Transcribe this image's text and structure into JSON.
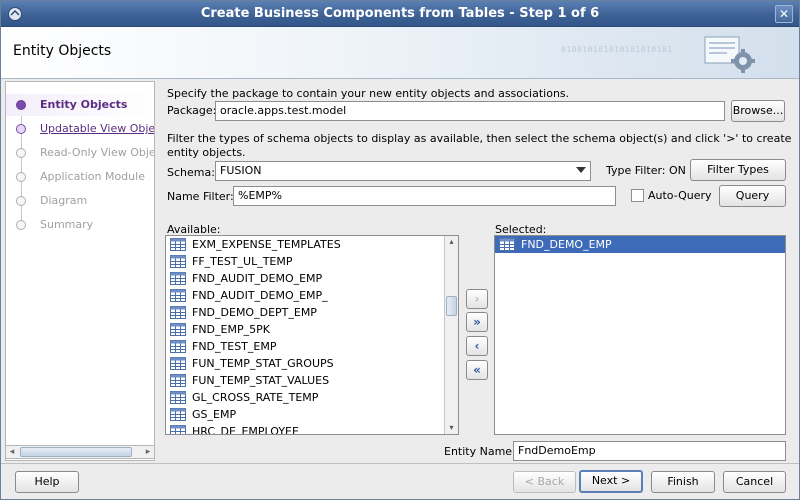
{
  "window": {
    "title": "Create Business Components from Tables - Step 1 of 6",
    "close_glyph": "✕"
  },
  "header": {
    "heading": "Entity Objects",
    "binary_text": "010010101010101010101"
  },
  "nav": {
    "items": [
      {
        "label": "Entity Objects"
      },
      {
        "label": "Updatable View Objects"
      },
      {
        "label": "Read-Only View Objects"
      },
      {
        "label": "Application Module"
      },
      {
        "label": "Diagram"
      },
      {
        "label": "Summary"
      }
    ],
    "scroll_left": "◂",
    "scroll_right": "▸"
  },
  "form": {
    "intro": "Specify the package to contain your new entity objects and associations.",
    "package_label": "Package:",
    "package_value": "oracle.apps.test.model",
    "browse_label": "Browse...",
    "filter_hint_line1": "Filter the types of schema objects to display as available, then select the schema object(s) and click '>' to create",
    "filter_hint_line2": "entity objects.",
    "schema_label": "Schema:",
    "schema_value": "FUSION",
    "type_filter_status": "Type Filter: ON",
    "filter_types_label": "Filter Types",
    "name_filter_label": "Name Filter:",
    "name_filter_value": "%EMP%",
    "auto_query_label": "Auto-Query",
    "query_label": "Query"
  },
  "available": {
    "label": "Available:",
    "items": [
      "EXM_EXPENSE_TEMPLATES",
      "FF_TEST_UL_TEMP",
      "FND_AUDIT_DEMO_EMP",
      "FND_AUDIT_DEMO_EMP_",
      "FND_DEMO_DEPT_EMP",
      "FND_EMP_5PK",
      "FND_TEST_EMP",
      "FUN_TEMP_STAT_GROUPS",
      "FUN_TEMP_STAT_VALUES",
      "GL_CROSS_RATE_TEMP",
      "GS_EMP",
      "HRC_DE_EMPLOYEE"
    ],
    "scroll_up": "▴",
    "scroll_down": "▾"
  },
  "shuttle": {
    "move": "›",
    "move_all": "»",
    "remove": "‹",
    "remove_all": "«"
  },
  "selected": {
    "label": "Selected:",
    "items": [
      "FND_DEMO_EMP"
    ]
  },
  "entity": {
    "label": "Entity Name:",
    "value": "FndDemoEmp"
  },
  "footer": {
    "help": "Help",
    "back": "< Back",
    "next": "Next >",
    "finish": "Finish",
    "cancel": "Cancel"
  }
}
